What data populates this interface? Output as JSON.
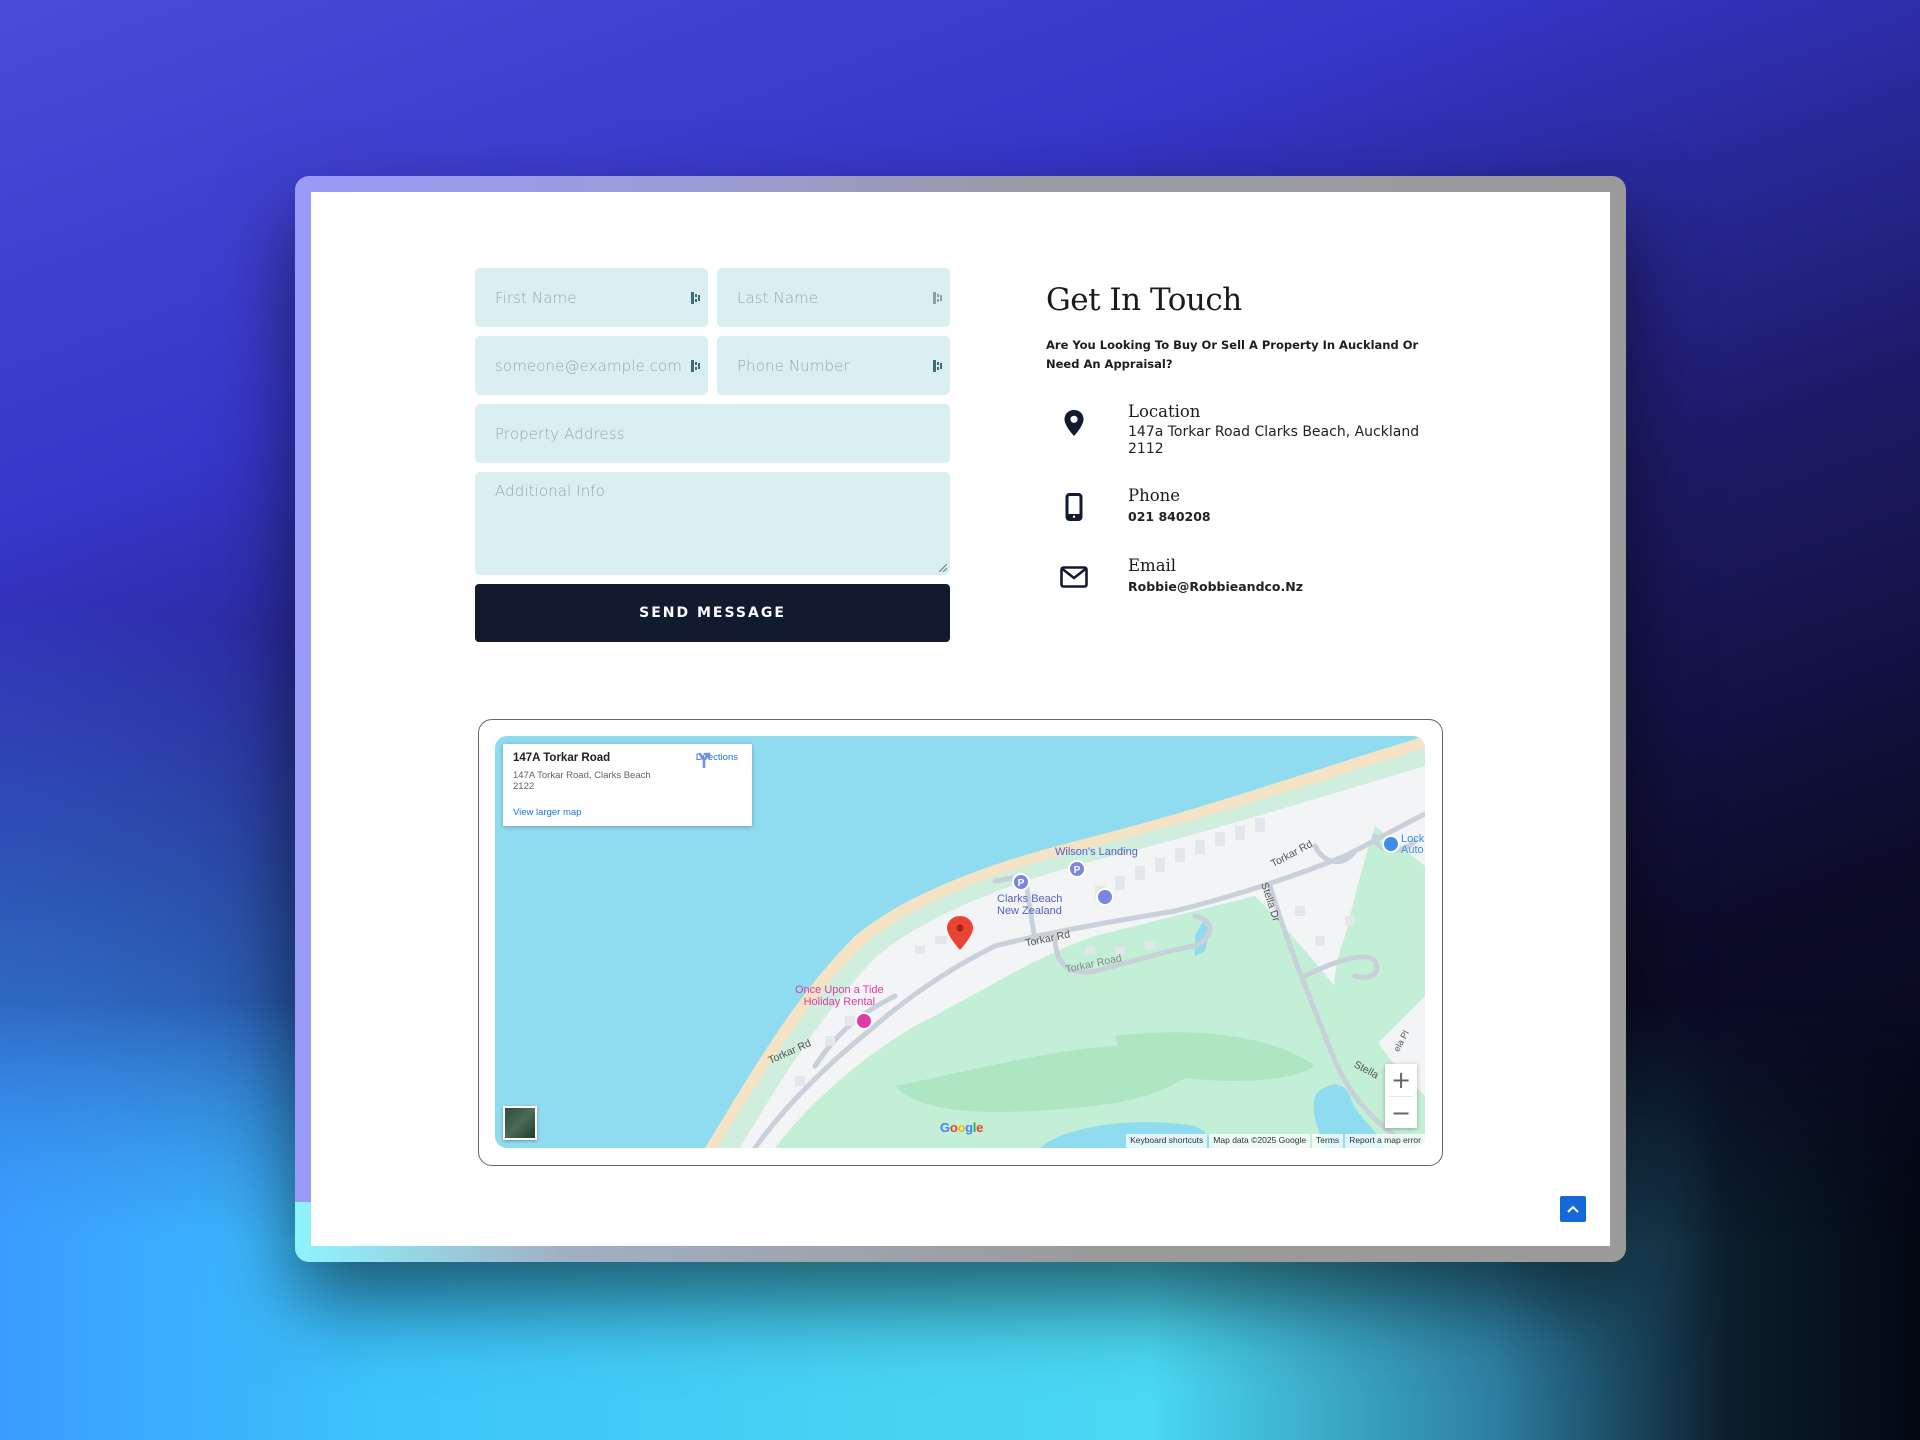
{
  "form": {
    "first_name_placeholder": "First Name",
    "last_name_placeholder": "Last Name",
    "email_placeholder": "someone@example.com",
    "phone_placeholder": "Phone Number",
    "address_placeholder": "Property Address",
    "info_placeholder": "Additional Info",
    "submit_label": "SEND MESSAGE"
  },
  "contact": {
    "title": "Get In Touch",
    "subtitle": "Are You Looking To Buy Or Sell A Property In Auckland Or Need An Appraisal?",
    "items": [
      {
        "icon": "map-pin-icon",
        "label": "Location",
        "value": "147a Torkar Road Clarks Beach, Auckland 2112"
      },
      {
        "icon": "mobile-phone-icon",
        "label": "Phone",
        "value": "021 840208"
      },
      {
        "icon": "envelope-icon",
        "label": "Email",
        "value": "Robbie@Robbieandco.Nz"
      }
    ]
  },
  "map": {
    "place_title": "147A Torkar Road",
    "place_address": "147A Torkar Road, Clarks Beach 2122",
    "directions_label": "Directions",
    "view_larger_label": "View larger map",
    "labels": {
      "wilsons_landing": "Wilson's Landing",
      "clarks_beach": "Clarks Beach\nNew Zealand",
      "torkar_rd": "Torkar Rd",
      "torkar_road": "Torkar Road",
      "stella_dr": "Stella Dr",
      "stella": "Stella",
      "ela_pl": "ela Pl",
      "once_upon": "Once Upon a Tide\nHoliday Rental",
      "lock_auto": "Lock\nAuto"
    },
    "zoom_in": "+",
    "zoom_out": "−",
    "google_logo": "Google",
    "attribution": [
      "Keyboard shortcuts",
      "Map data ©2025 Google",
      "Terms",
      "Report a map error"
    ]
  },
  "colors": {
    "input_bg": "#d9eff1",
    "button_bg": "#111a2e",
    "accent_blue": "#1468d8",
    "map_water": "#8fdbef",
    "map_land": "#f3f4f6",
    "map_park": "#c2efd5"
  }
}
